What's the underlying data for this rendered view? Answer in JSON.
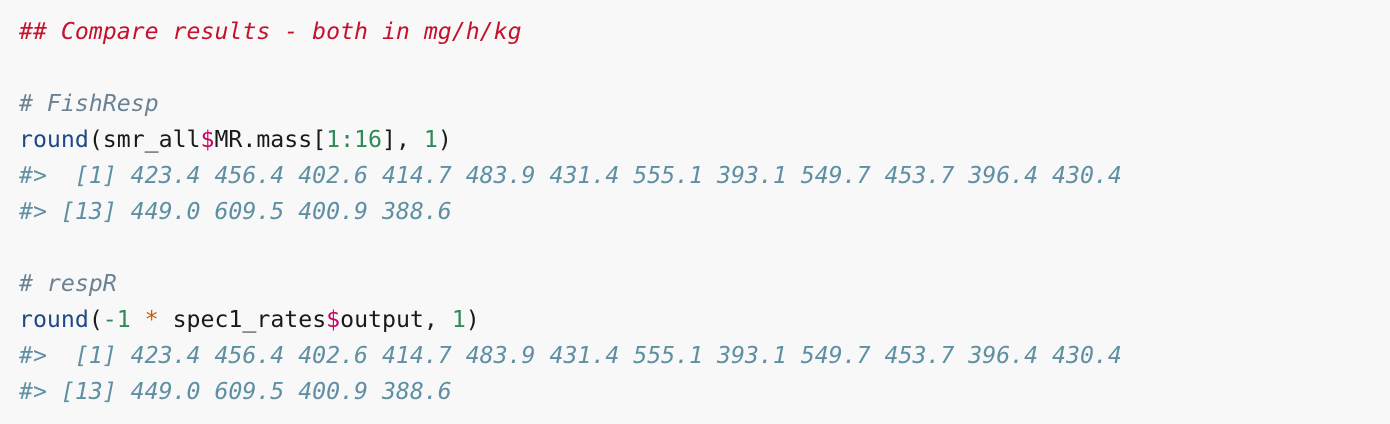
{
  "code": {
    "comment_main": "## Compare results - both in mg/h/kg",
    "comment_fishresp": "# FishResp",
    "call1": {
      "fn": "round",
      "open": "(smr_all",
      "dollar": "$",
      "field": "MR.mass[",
      "idx": "1:16",
      "close": "], ",
      "digits": "1",
      "end": ")"
    },
    "out1_line1": "#>  [1] 423.4 456.4 402.6 414.7 483.9 431.4 555.1 393.1 549.7 453.7 396.4 430.4",
    "out1_line2": "#> [13] 449.0 609.5 400.9 388.6",
    "comment_respr": "# respR",
    "call2": {
      "fn": "round",
      "open": "(",
      "neg": "-1",
      "op": " * ",
      "obj": "spec1_rates",
      "dollar": "$",
      "field": "output, ",
      "digits": "1",
      "end": ")"
    },
    "out2_line1": "#>  [1] 423.4 456.4 402.6 414.7 483.9 431.4 555.1 393.1 549.7 453.7 396.4 430.4",
    "out2_line2": "#> [13] 449.0 609.5 400.9 388.6"
  }
}
